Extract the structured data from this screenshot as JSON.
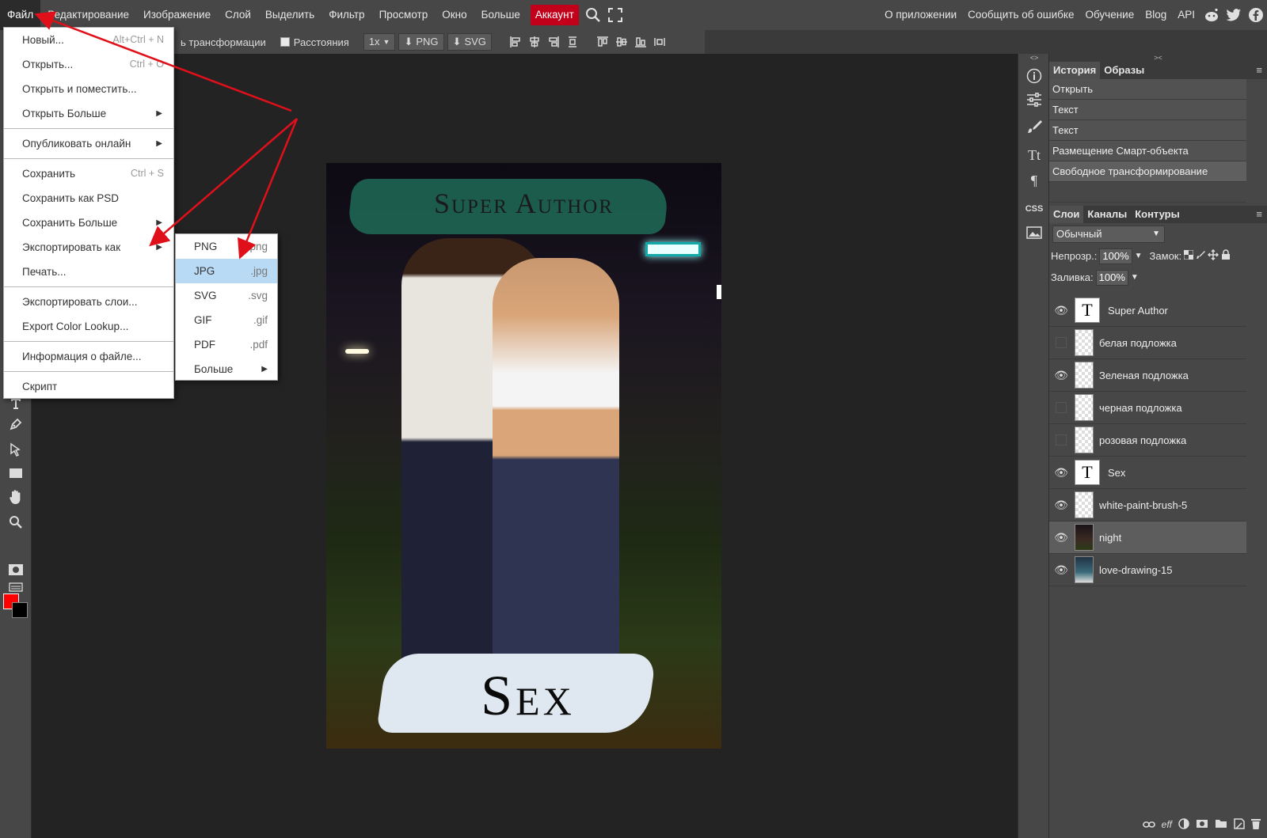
{
  "menubar": {
    "items": [
      "Файл",
      "Редактирование",
      "Изображение",
      "Слой",
      "Выделить",
      "Фильтр",
      "Просмотр",
      "Окно",
      "Больше"
    ],
    "account": "Аккаунт",
    "right_items": [
      "О приложении",
      "Сообщить об ошибке",
      "Обучение",
      "Blog",
      "API"
    ]
  },
  "optbar": {
    "transform_label": "ь трансформации",
    "distances_label": "Расстояния",
    "scale": "1x",
    "png_label": "PNG",
    "svg_label": "SVG"
  },
  "file_menu": {
    "items": [
      {
        "label": "Новый...",
        "shortcut": "Alt+Ctrl + N"
      },
      {
        "label": "Открыть...",
        "shortcut": "Ctrl + O"
      },
      {
        "label": "Открыть и поместить...",
        "shortcut": ""
      },
      {
        "label": "Открыть Больше",
        "shortcut": ""
      },
      {
        "label": "Опубликовать онлайн",
        "shortcut": ""
      },
      {
        "label": "Сохранить",
        "shortcut": "Ctrl + S"
      },
      {
        "label": "Сохранить как PSD",
        "shortcut": ""
      },
      {
        "label": "Сохранить Больше",
        "shortcut": ""
      },
      {
        "label": "Экспортировать как",
        "shortcut": ""
      },
      {
        "label": "Печать...",
        "shortcut": ""
      },
      {
        "label": "Экспортировать слои...",
        "shortcut": ""
      },
      {
        "label": "Export Color Lookup...",
        "shortcut": ""
      },
      {
        "label": "Информация о файле...",
        "shortcut": ""
      },
      {
        "label": "Скрипт",
        "shortcut": ""
      }
    ]
  },
  "export_menu": {
    "items": [
      {
        "label": "PNG",
        "ext": ".png"
      },
      {
        "label": "JPG",
        "ext": ".jpg"
      },
      {
        "label": "SVG",
        "ext": ".svg"
      },
      {
        "label": "GIF",
        "ext": ".gif"
      },
      {
        "label": "PDF",
        "ext": ".pdf"
      },
      {
        "label": "Больше",
        "ext": ""
      }
    ],
    "highlighted": "JPG"
  },
  "canvas": {
    "title_top": "Super Author",
    "title_bottom": "Sex"
  },
  "panel_history": {
    "tabs": [
      "История",
      "Образы"
    ],
    "rows": [
      "Открыть",
      "Текст",
      "Текст",
      "Размещение Смарт-объекта",
      "Свободное трансформирование"
    ]
  },
  "panel_layers": {
    "tabs": [
      "Слои",
      "Каналы",
      "Контуры"
    ],
    "blend_mode": "Обычный",
    "opacity_label": "Непрозр.:",
    "opacity_value": "100%",
    "lock_label": "Замок:",
    "fill_label": "Заливка:",
    "fill_value": "100%",
    "layers": [
      {
        "name": "Super Author",
        "visible": true,
        "kind": "text"
      },
      {
        "name": "белая подложка",
        "visible": false,
        "kind": "raster"
      },
      {
        "name": "Зеленая подложка",
        "visible": true,
        "kind": "raster"
      },
      {
        "name": "черная подложка",
        "visible": false,
        "kind": "raster"
      },
      {
        "name": "розовая подложка",
        "visible": false,
        "kind": "raster"
      },
      {
        "name": "Sex",
        "visible": true,
        "kind": "text"
      },
      {
        "name": "white-paint-brush-5",
        "visible": true,
        "kind": "raster"
      },
      {
        "name": "night",
        "visible": true,
        "kind": "photo",
        "selected": true
      },
      {
        "name": "love-drawing-15",
        "visible": true,
        "kind": "photo2"
      }
    ]
  },
  "colors": {
    "foreground": "#ff0000",
    "background": "#000000",
    "account_bg": "#c3001a",
    "arrow": "#e0101a"
  }
}
